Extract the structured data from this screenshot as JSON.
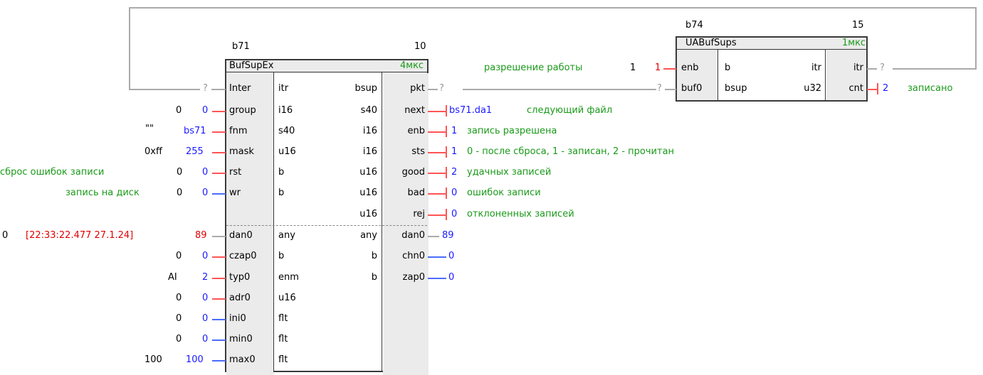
{
  "b71": {
    "id": "b71",
    "order": "10",
    "type": "BufSupEx",
    "time": "4мкс",
    "inputs": [
      "Inter",
      "group",
      "fnm",
      "mask",
      "rst",
      "wr",
      "",
      "dan0",
      "czap0",
      "typ0",
      "adr0",
      "ini0",
      "min0",
      "max0"
    ],
    "in_types": [
      "itr",
      "i16",
      "s40",
      "u16",
      "b",
      "b",
      "",
      "any",
      "b",
      "enm",
      "u16",
      "flt",
      "flt",
      "flt"
    ],
    "out_types": [
      "bsup",
      "s40",
      "i16",
      "i16",
      "u16",
      "u16",
      "u16",
      "any",
      "b",
      "b"
    ],
    "outputs": [
      "pkt",
      "next",
      "enb",
      "sts",
      "good",
      "bad",
      "rej",
      "dan0",
      "chn0",
      "zap0"
    ],
    "in_values": [
      "?",
      "0",
      "bs71",
      "255",
      "0",
      "0",
      "",
      "89",
      "0",
      "2",
      "0",
      "0",
      "0",
      "100"
    ],
    "in_consts": [
      "",
      "0",
      "\"\"",
      "0xff",
      "0",
      "0",
      "",
      "0",
      "0",
      "AI",
      "0",
      "0",
      "0",
      "100"
    ],
    "in_labels": [
      "",
      "",
      "",
      "",
      "сброс ошибок записи",
      "запись на диск",
      "",
      "",
      "",
      "",
      "",
      "",
      "",
      ""
    ],
    "dan0_stamp": "[22:33:22.477 27.1.24]",
    "out_values": [
      "?",
      "bs71.da1",
      "1",
      "1",
      "2",
      "0",
      "0",
      "89",
      "0",
      "0"
    ],
    "out_labels": [
      "",
      "следующий файл",
      "запись разрешена",
      "0 - после сброса, 1 - записан, 2 - прочитан",
      "удачных записей",
      "ошибок записи",
      "отклоненных записей",
      "",
      "",
      ""
    ]
  },
  "b74": {
    "id": "b74",
    "order": "15",
    "type": "UABufSups",
    "time": "1мкс",
    "inputs": [
      "enb",
      "buf0"
    ],
    "in_types": [
      "b",
      "bsup"
    ],
    "out_types": [
      "itr",
      "u32"
    ],
    "outputs": [
      "itr",
      "cnt"
    ],
    "enb_label": "разрешение работы",
    "enb_const": "1",
    "enb_value": "1",
    "buf0_value": "?",
    "itr_value": "?",
    "cnt_value": "2",
    "cnt_label": "записано"
  }
}
